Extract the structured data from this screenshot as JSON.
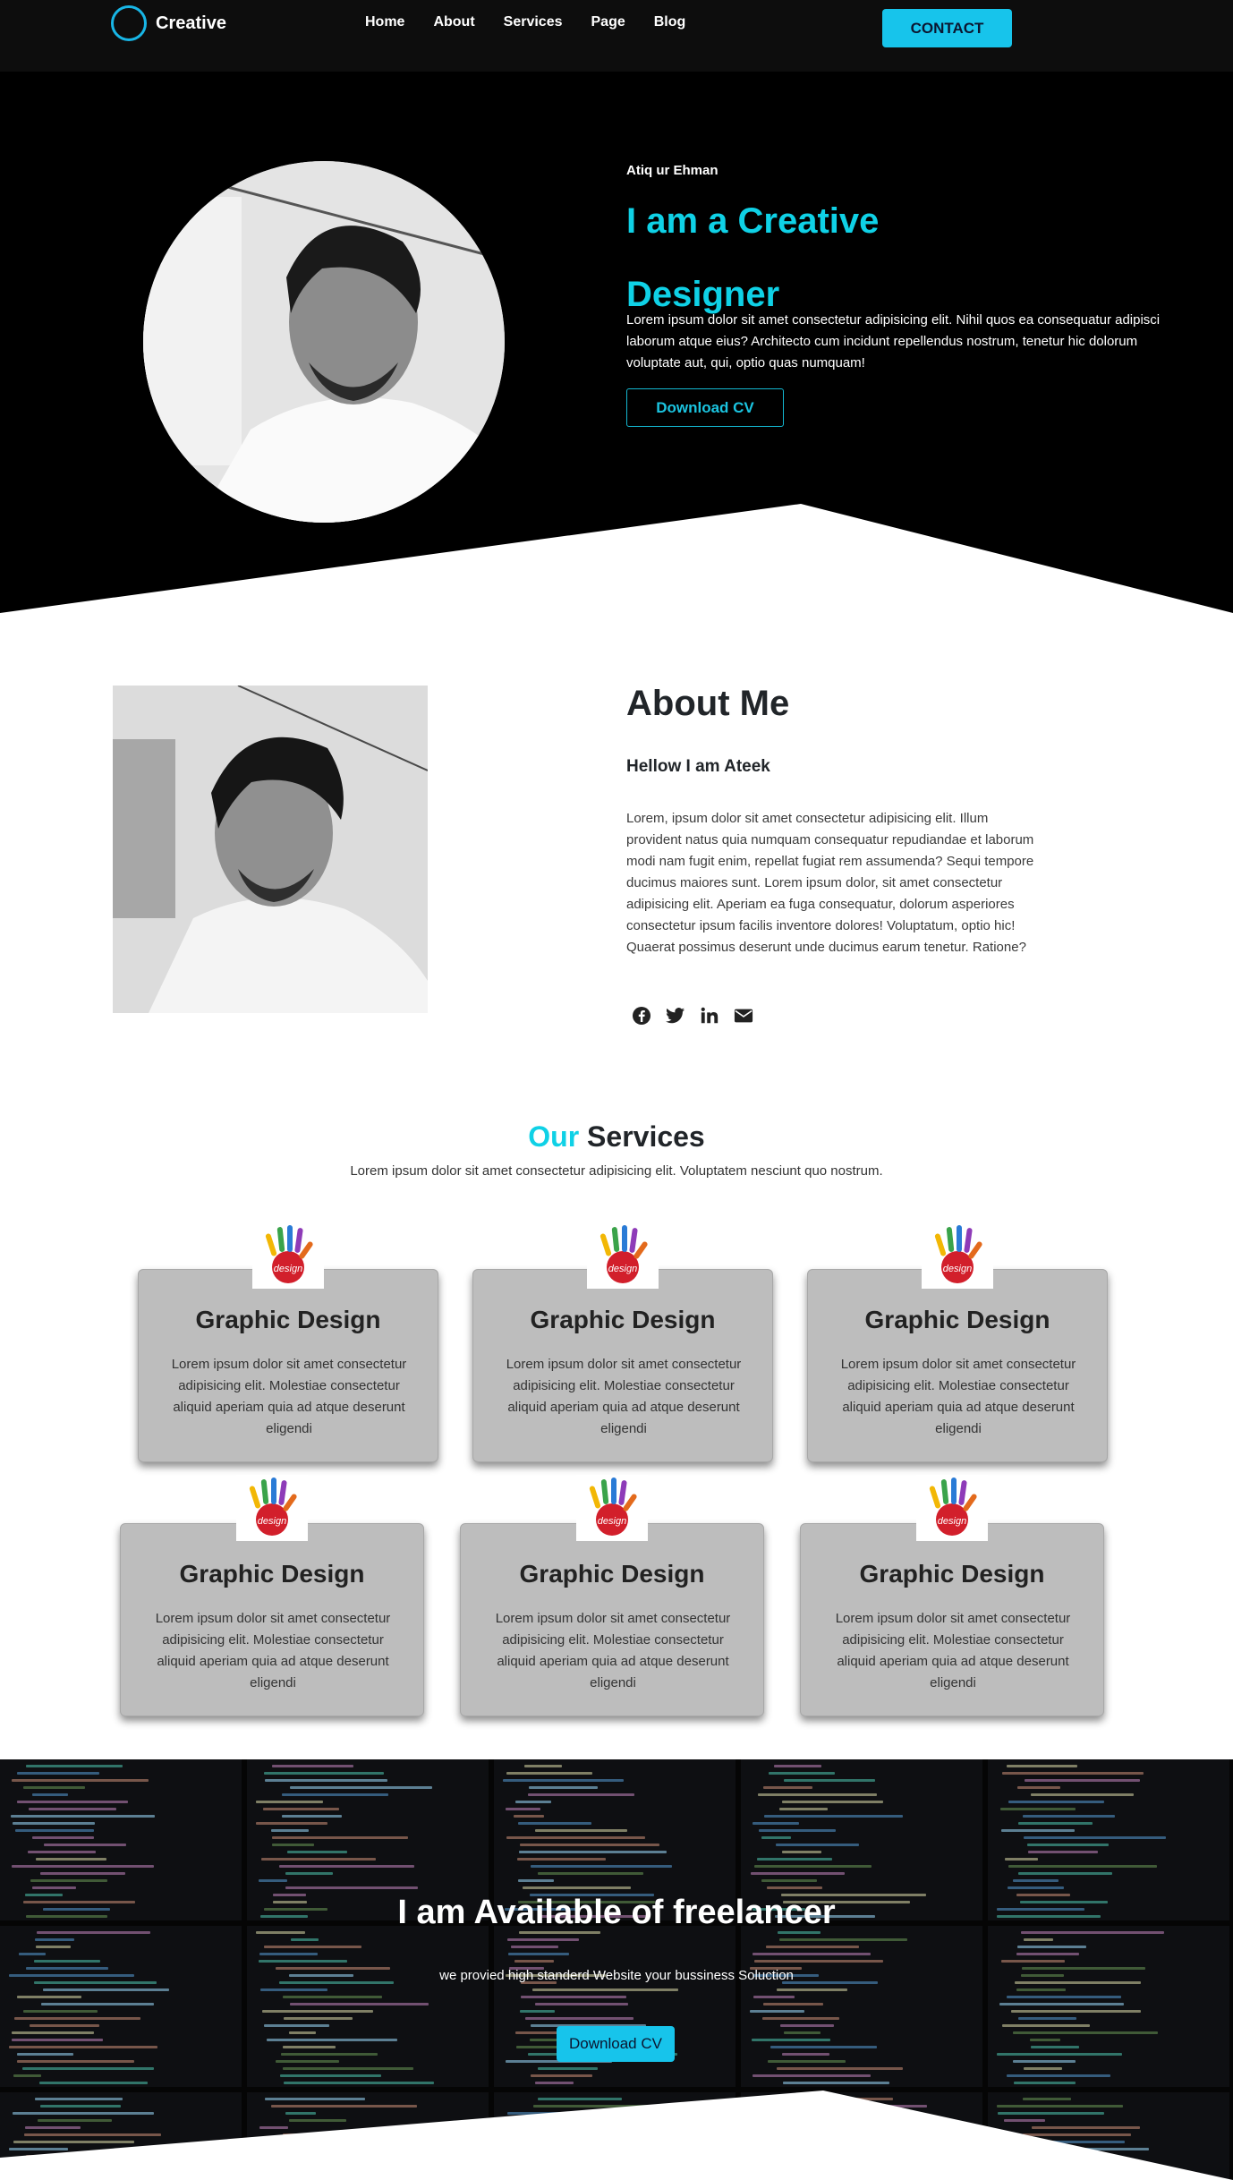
{
  "nav": {
    "brand": "Creative",
    "links": [
      "Home",
      "About",
      "Services",
      "Page",
      "Blog"
    ],
    "contact": "CONTACT"
  },
  "hero": {
    "name": "Atiq ur Ehman",
    "title": "I am a Creative Designer",
    "description": "Lorem ipsum dolor sit amet consectetur adipisicing elit. Nihil quos ea consequatur adipisci laborum atque eius? Architecto cum incidunt repellendus nostrum, tenetur hic dolorum voluptate aut, qui, optio quas numquam!",
    "button": "Download CV"
  },
  "about": {
    "title": "About Me",
    "subtitle": "Hellow I am Ateek",
    "text": "Lorem, ipsum dolor sit amet consectetur adipisicing elit. Illum provident natus quia numquam consequatur repudiandae et laborum modi nam fugit enim, repellat fugiat rem assumenda? Sequi tempore ducimus maiores sunt. Lorem ipsum dolor, sit amet consectetur adipisicing elit. Aperiam ea fuga consequatur, dolorum asperiores consectetur ipsum facilis inventore dolores! Voluptatum, optio hic! Quaerat possimus deserunt unde ducimus earum tenetur. Ratione?",
    "social_icons": [
      "facebook-icon",
      "twitter-icon",
      "linkedin-icon",
      "envelope-icon"
    ]
  },
  "services": {
    "title_accent": "Our",
    "title_rest": "Services",
    "description": "Lorem ipsum dolor sit amet consectetur adipisicing elit. Voluptatem nesciunt quo nostrum.",
    "logo_text": "design",
    "cards": [
      {
        "title": "Graphic Design",
        "text": "Lorem ipsum dolor sit amet consectetur adipisicing elit. Molestiae consectetur aliquid aperiam quia ad atque deserunt eligendi"
      },
      {
        "title": "Graphic Design",
        "text": "Lorem ipsum dolor sit amet consectetur adipisicing elit. Molestiae consectetur aliquid aperiam quia ad atque deserunt eligendi"
      },
      {
        "title": "Graphic Design",
        "text": "Lorem ipsum dolor sit amet consectetur adipisicing elit. Molestiae consectetur aliquid aperiam quia ad atque deserunt eligendi"
      },
      {
        "title": "Graphic Design",
        "text": "Lorem ipsum dolor sit amet consectetur adipisicing elit. Molestiae consectetur aliquid aperiam quia ad atque deserunt eligendi"
      },
      {
        "title": "Graphic Design",
        "text": "Lorem ipsum dolor sit amet consectetur adipisicing elit. Molestiae consectetur aliquid aperiam quia ad atque deserunt eligendi"
      },
      {
        "title": "Graphic Design",
        "text": "Lorem ipsum dolor sit amet consectetur adipisicing elit. Molestiae consectetur aliquid aperiam quia ad atque deserunt eligendi"
      }
    ]
  },
  "freelance": {
    "title": "I am Available of freelancer",
    "description": "we provied high standerd Website your bussiness Soluction",
    "button": "Download CV"
  },
  "colors": {
    "accent": "#0fd1e6",
    "button": "#17c4eb",
    "dark": "#000000",
    "card": "#bdbdbd"
  }
}
